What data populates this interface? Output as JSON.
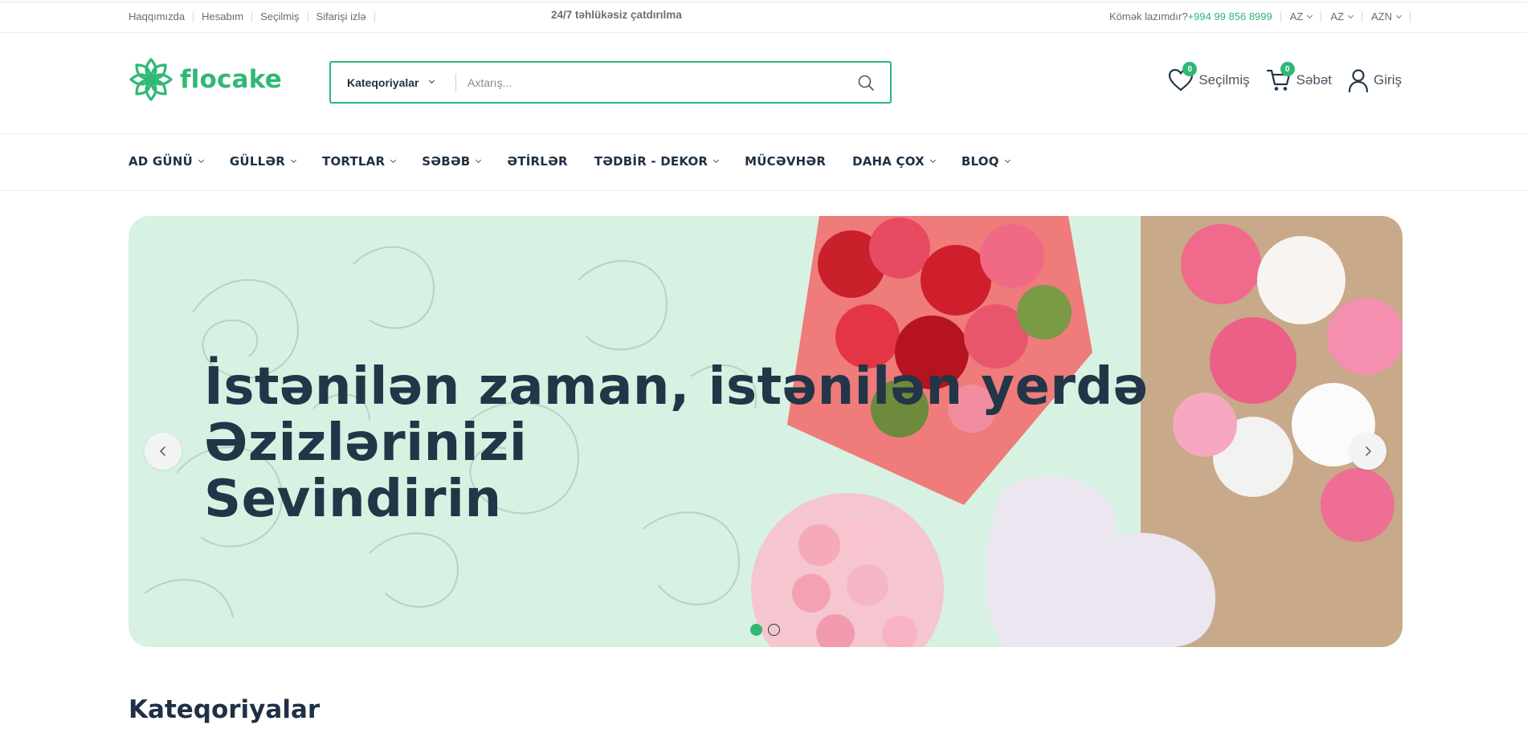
{
  "topbar": {
    "links": [
      "Haqqımızda",
      "Hesabım",
      "Seçilmiş",
      "Sifarişi izlə"
    ],
    "promo": "24/7 təhlükəsiz çatdırılma",
    "help_label": "Kömək lazımdır?",
    "phone": "+994 99 856 8999",
    "language_1": "AZ",
    "language_2": "AZ",
    "currency": "AZN"
  },
  "header": {
    "logo_text": "flocake",
    "search": {
      "category_label": "Kateqoriyalar",
      "placeholder": "Axtarış..."
    },
    "wishlist": {
      "label": "Seçilmiş",
      "count": "0"
    },
    "cart": {
      "label": "Səbət",
      "count": "0"
    },
    "login": {
      "label": "Giriş"
    }
  },
  "nav": {
    "items": [
      {
        "label": "AD GÜNÜ",
        "dropdown": true
      },
      {
        "label": "GÜLLƏR",
        "dropdown": true
      },
      {
        "label": "TORTLAR",
        "dropdown": true
      },
      {
        "label": "SƏBƏB",
        "dropdown": true
      },
      {
        "label": "ƏTİRLƏR",
        "dropdown": false
      },
      {
        "label": "TƏDBİR - DEKOR",
        "dropdown": true
      },
      {
        "label": "MÜCƏVHƏR",
        "dropdown": false
      },
      {
        "label": "DAHA ÇOX",
        "dropdown": true
      },
      {
        "label": "BLOQ",
        "dropdown": true
      }
    ]
  },
  "hero": {
    "headline_line1": "İstənilən zaman, istənilən yerdə Əzizlərinizi",
    "headline_line2": "Sevindirin",
    "slide_count": 2,
    "active_slide": 1
  },
  "sections": {
    "categories_title": "Kateqoriyalar"
  },
  "colors": {
    "brand_green": "#2fb874",
    "text_dark": "#1f3045",
    "hero_bg": "#d7f2e2"
  },
  "icons": [
    "logo-flower-icon",
    "search-icon",
    "heart-icon",
    "cart-icon",
    "user-icon",
    "chevron-left-icon",
    "chevron-right-icon",
    "chevron-down-icon"
  ]
}
